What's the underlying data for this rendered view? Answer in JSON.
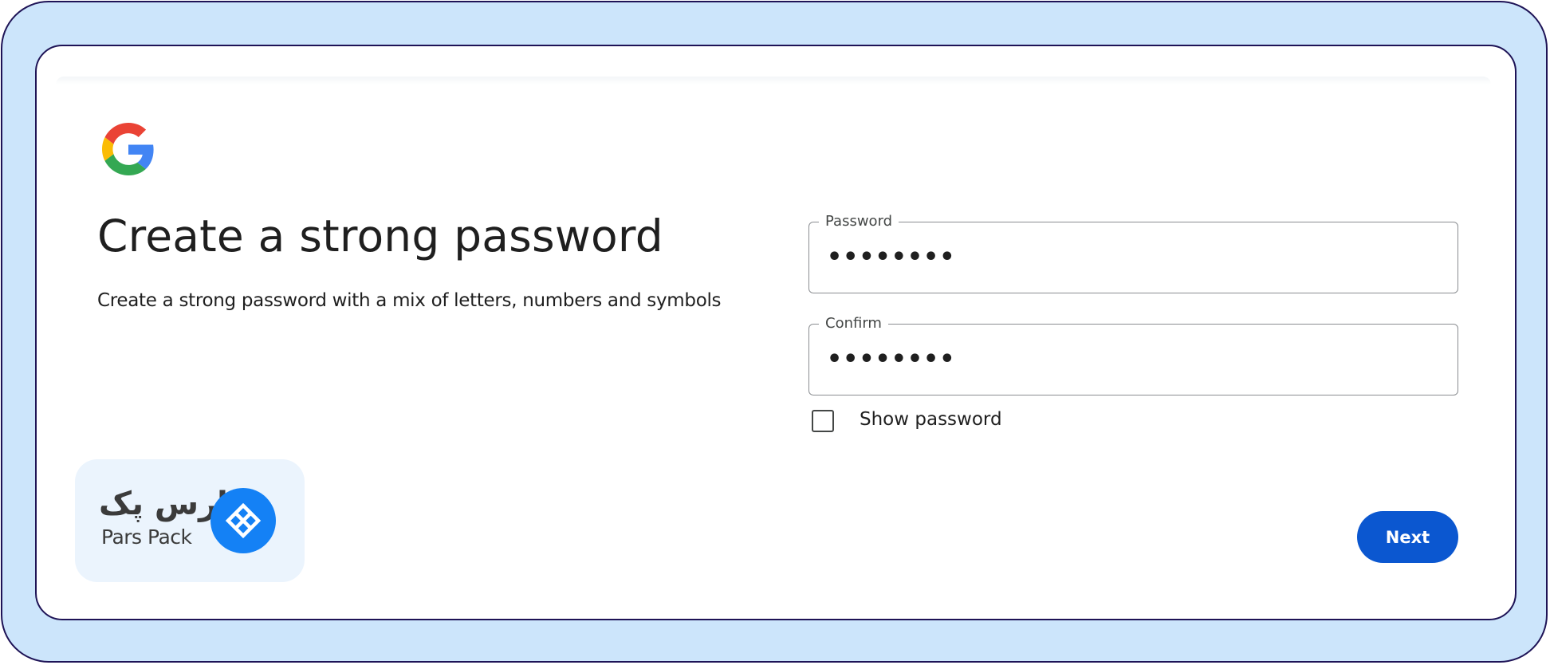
{
  "page": {
    "heading": "Create a strong password",
    "subtext": "Create a strong password with a mix of letters, numbers and symbols"
  },
  "form": {
    "password": {
      "label": "Password",
      "value": "••••••••"
    },
    "confirm": {
      "label": "Confirm",
      "value": "••••••••"
    },
    "show_password": {
      "label": "Show password",
      "checked": false
    }
  },
  "actions": {
    "next_label": "Next"
  },
  "branding": {
    "logo_text_fa": "پارس پک",
    "logo_text_en": "Pars Pack",
    "icon": "parspack-diamond-icon",
    "accent": "#1481f5"
  },
  "colors": {
    "frame_background": "#cce5fb",
    "frame_border": "#1e1356",
    "button": "#0b57d0",
    "google_blue": "#4285f4",
    "google_red": "#ea4335",
    "google_yellow": "#fbbc05",
    "google_green": "#34a853"
  },
  "icons": [
    "google-g-icon",
    "parspack-diamond-icon"
  ]
}
